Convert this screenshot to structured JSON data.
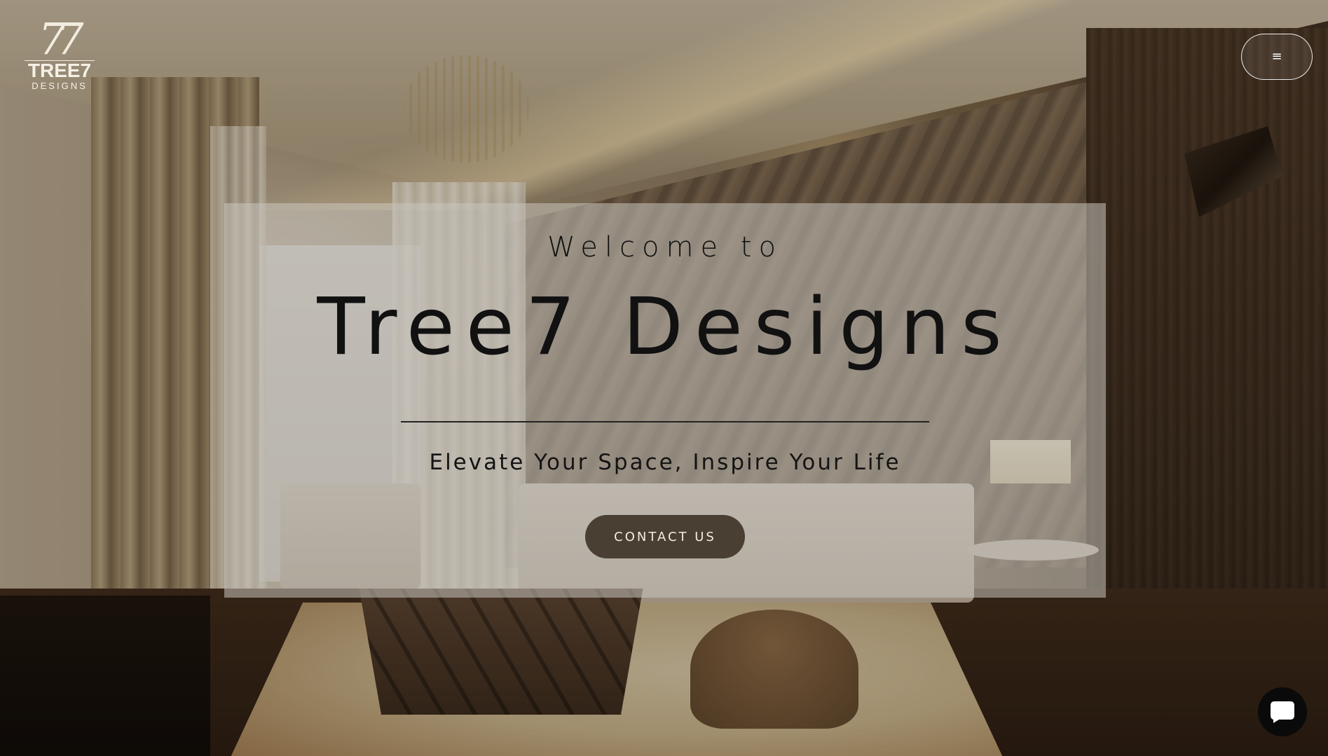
{
  "header": {
    "logo": {
      "mark": "7",
      "name": "TREE7",
      "sub": "DESIGNS"
    },
    "menu_icon": "hamburger-icon",
    "menu_glyph": "≡"
  },
  "hero": {
    "welcome": "Welcome to",
    "title": "Tree7 Designs",
    "tagline": "Elevate Your Space, Inspire Your Life",
    "cta_label": "CONTACT US"
  },
  "chat": {
    "icon": "chat-bubble-icon"
  },
  "colors": {
    "cta_background": "#4a3f33",
    "panel_background": "rgba(200,196,190,0.55)",
    "chat_background": "#0a0a0a"
  }
}
